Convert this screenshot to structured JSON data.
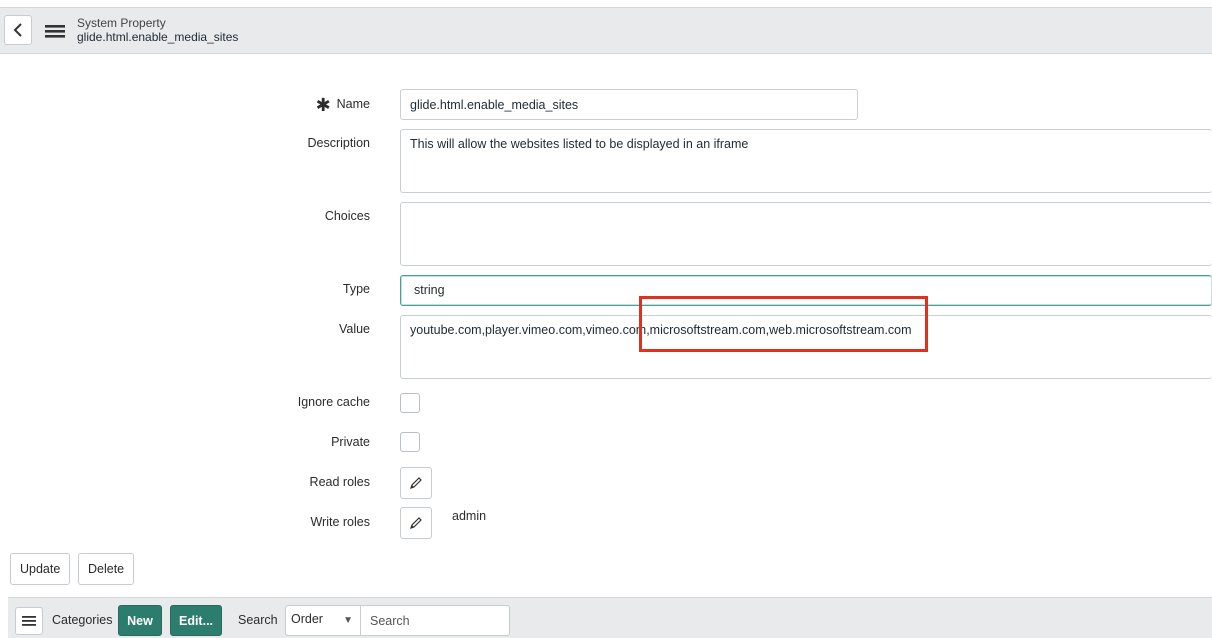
{
  "header": {
    "table_label": "System Property",
    "record_name": "glide.html.enable_media_sites"
  },
  "form": {
    "name": {
      "label": "Name",
      "value": "glide.html.enable_media_sites"
    },
    "description": {
      "label": "Description",
      "value": "This will allow the websites listed to be displayed in an iframe"
    },
    "choices": {
      "label": "Choices",
      "value": ""
    },
    "type": {
      "label": "Type",
      "value": "string"
    },
    "value": {
      "label": "Value",
      "value": "youtube.com,player.vimeo.com,vimeo.com,microsoftstream.com,web.microsoftstream.com"
    },
    "ignore_cache": {
      "label": "Ignore cache",
      "checked": false
    },
    "private": {
      "label": "Private",
      "checked": false
    },
    "read_roles": {
      "label": "Read roles",
      "value": ""
    },
    "write_roles": {
      "label": "Write roles",
      "value": "admin"
    }
  },
  "actions": {
    "update_label": "Update",
    "delete_label": "Delete"
  },
  "related": {
    "categories_label": "Categories",
    "new_label": "New",
    "edit_label": "Edit...",
    "search_label": "Search",
    "search_field_selected": "Order",
    "search_placeholder": "Search"
  },
  "colors": {
    "highlight": "#e0301e",
    "primary_button": "#2d7d6e"
  }
}
